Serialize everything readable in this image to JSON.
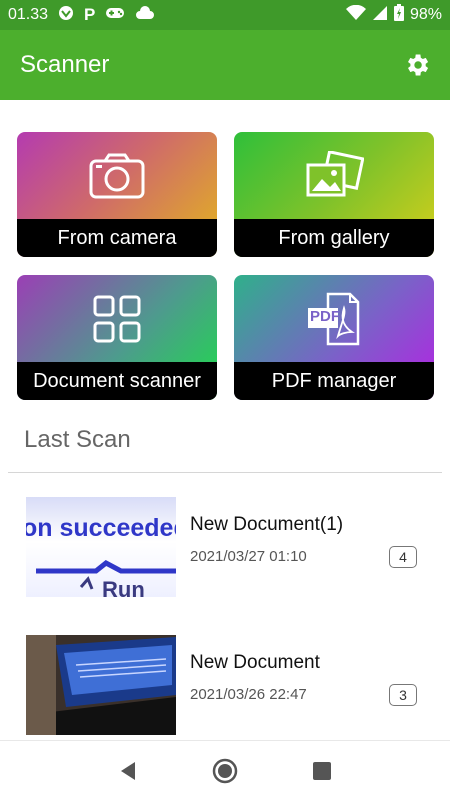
{
  "status_bar": {
    "time": "01.33",
    "battery": "98%",
    "icons": [
      "vpn-icon",
      "p-notification-icon",
      "gamepad-icon",
      "cloud-icon",
      "wifi-icon",
      "signal-icon",
      "battery-charging-icon"
    ]
  },
  "app_bar": {
    "title": "Scanner",
    "settings_icon": "gear-icon",
    "background": "#4caf2d"
  },
  "tiles": [
    {
      "label": "From camera",
      "icon": "camera-icon"
    },
    {
      "label": "From gallery",
      "icon": "gallery-icon"
    },
    {
      "label": "Document scanner",
      "icon": "grid-icon"
    },
    {
      "label": "PDF manager",
      "icon": "pdf-icon",
      "icon_text": "PDF"
    }
  ],
  "last_scan": {
    "title": "Last Scan",
    "items": [
      {
        "name": "New Document(1)",
        "date": "2021/03/27 01:10",
        "pages": "4",
        "thumb_text": "on succeeded",
        "thumb_text2": "Run"
      },
      {
        "name": "New Document",
        "date": "2021/03/26 22:47",
        "pages": "3"
      }
    ]
  },
  "nav_bar": {
    "icons": [
      "back-icon",
      "home-icon",
      "recents-icon"
    ]
  }
}
